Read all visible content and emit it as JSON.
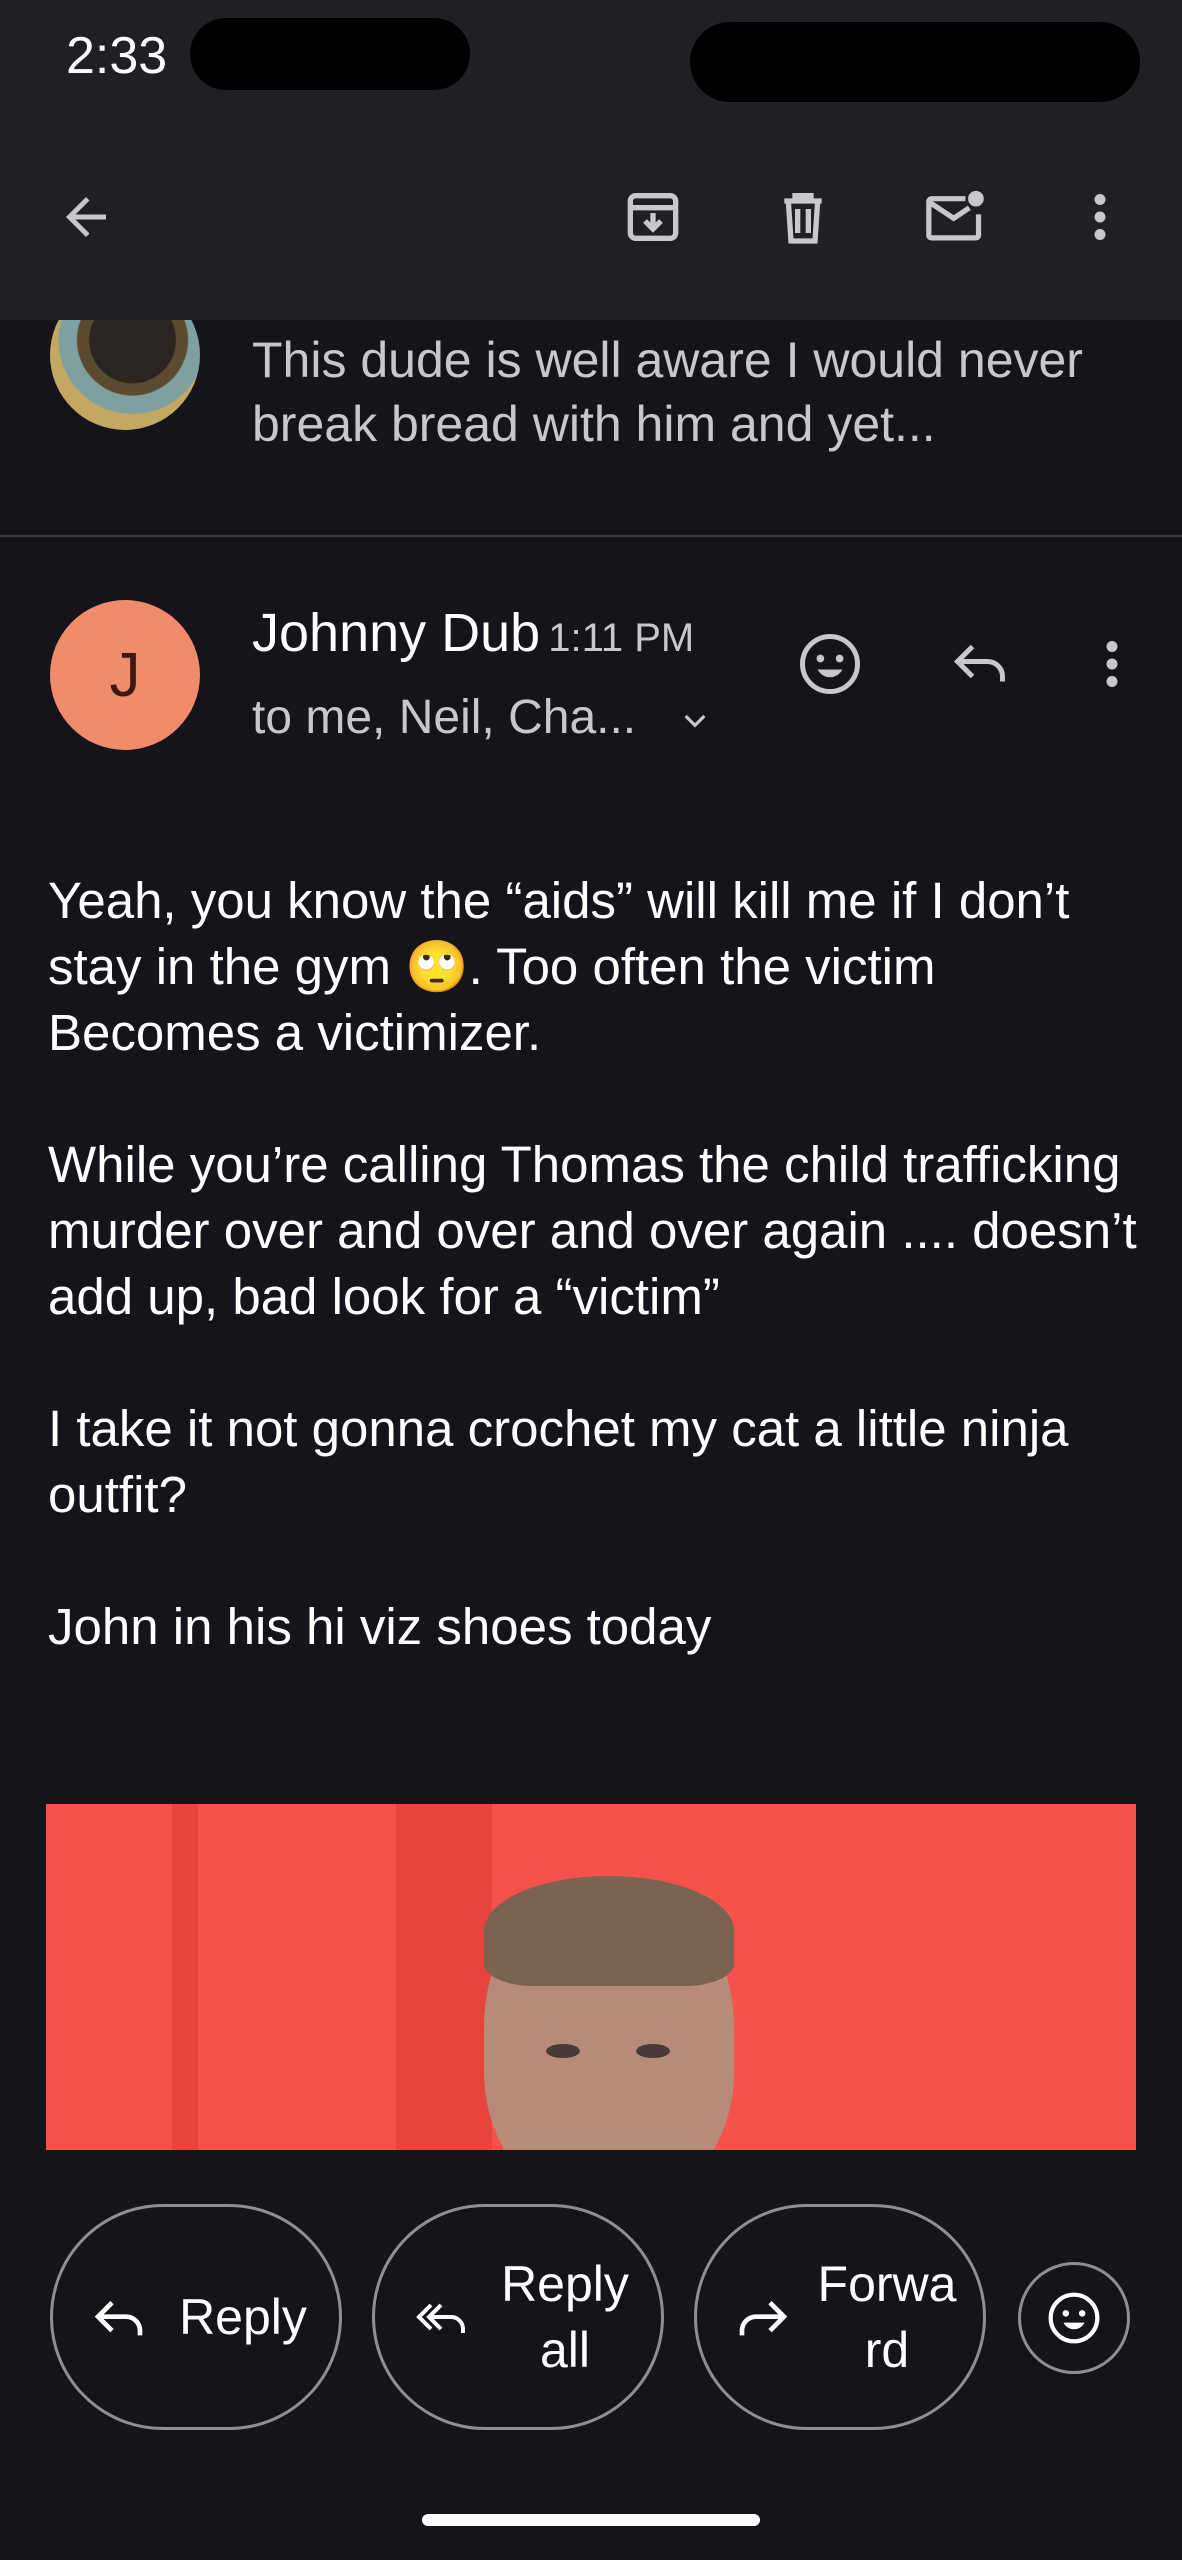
{
  "status_bar": {
    "time": "2:33"
  },
  "toolbar": {
    "back_icon": "arrow-back-icon",
    "archive_icon": "archive-icon",
    "delete_icon": "trash-icon",
    "mark_unread_icon": "mark-unread-icon",
    "more_icon": "more-vert-icon"
  },
  "previous_message": {
    "snippet": "This dude is well aware I would never break bread with him and yet..."
  },
  "message": {
    "avatar_letter": "J",
    "avatar_color": "#f28b6b",
    "sender": "Johnny Dub",
    "time": "1:11 PM",
    "recipients": "to me, Neil, Cha...",
    "paragraphs": [
      "Yeah, you know the “aids” will kill me if I don’t stay in the gym 🙄. Too often the victim Becomes a victimizer.",
      "While you’re calling Thomas the child trafficking murder over and over and over again .... doesn’t add up, bad look for a “victim”",
      "I take it  not gonna crochet my cat a little ninja outfit?",
      "John in his hi viz shoes today"
    ]
  },
  "actions": {
    "reply": "Reply",
    "reply_all": "Reply all",
    "forward": "Forwa rd"
  },
  "colors": {
    "background": "#14141a",
    "bar": "#1f1f24",
    "accent_avatar": "#f28b6b"
  }
}
